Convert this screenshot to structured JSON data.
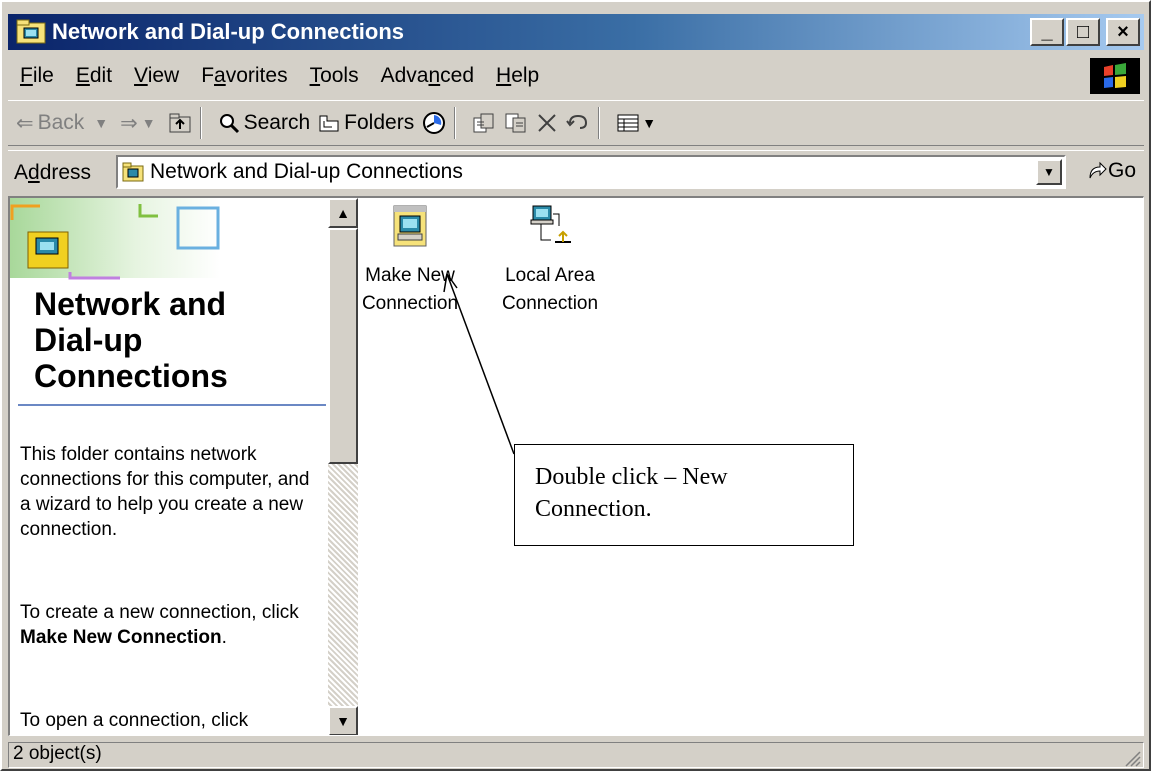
{
  "window": {
    "title": "Network and Dial-up Connections"
  },
  "title_buttons": {
    "minimize": "_",
    "maximize": "□",
    "close": "×"
  },
  "menu": [
    {
      "prefix": "",
      "key": "F",
      "rest": "ile"
    },
    {
      "prefix": "",
      "key": "E",
      "rest": "dit"
    },
    {
      "prefix": "",
      "key": "V",
      "rest": "iew"
    },
    {
      "prefix": "F",
      "key": "a",
      "rest": "vorites"
    },
    {
      "prefix": "",
      "key": "T",
      "rest": "ools"
    },
    {
      "prefix": "Adva",
      "key": "n",
      "rest": "ced"
    },
    {
      "prefix": "",
      "key": "H",
      "rest": "elp"
    }
  ],
  "toolbar": {
    "back_label": "Back",
    "search_label": "Search",
    "folders_label": "Folders"
  },
  "address": {
    "label_prefix": "A",
    "label_key": "d",
    "label_rest": "dress",
    "value": "Network and Dial-up Connections",
    "go_label": "Go"
  },
  "left_pane": {
    "title_line1": "Network and",
    "title_line2": "Dial-up",
    "title_line3": "Connections",
    "para1": "This folder contains network connections for this computer, and a wizard to help you create a new connection.",
    "para2_text": "To create a new connection, click ",
    "para2_bold": "Make New Connection",
    "para2_end": ".",
    "para3": "To open a connection, click"
  },
  "items": [
    {
      "line1": "Make New",
      "line2": "Connection",
      "icon": "make-new-connection-icon"
    },
    {
      "line1": "Local Area",
      "line2": "Connection",
      "icon": "lan-connection-icon"
    }
  ],
  "callout": {
    "line1": "Double click – New",
    "line2": "Connection."
  },
  "status": {
    "text": "2 object(s)"
  }
}
